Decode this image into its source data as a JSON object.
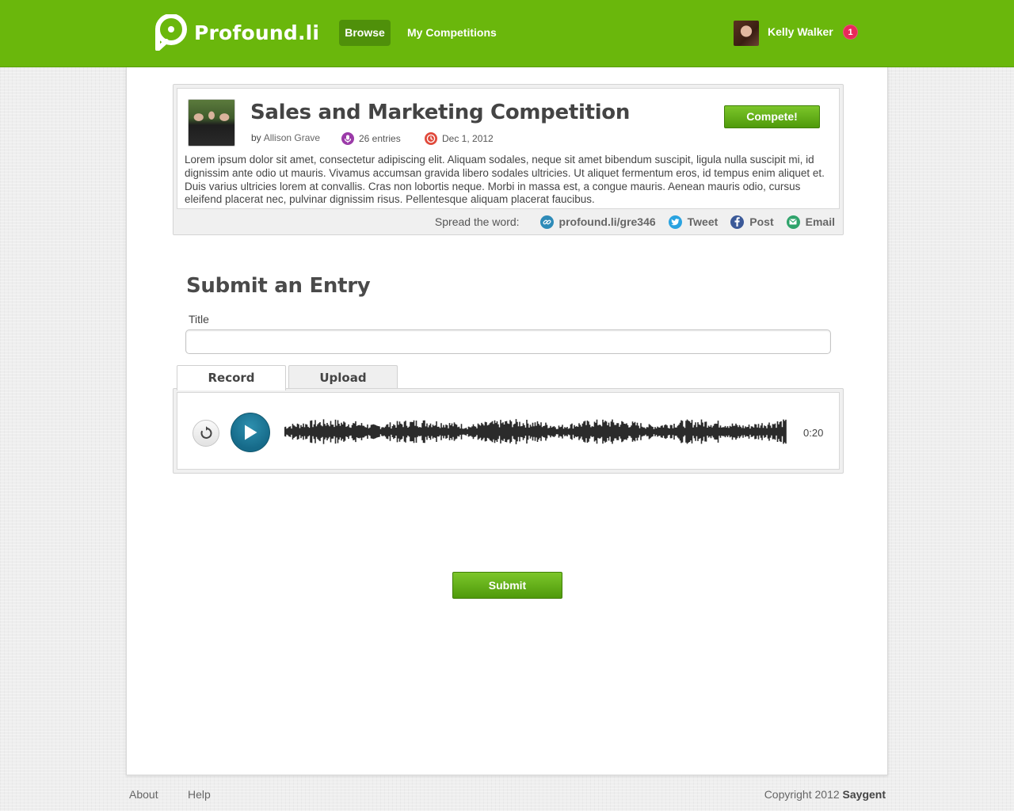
{
  "header": {
    "logo_text": "Profound.li",
    "nav": {
      "browse": "Browse",
      "my_competitions": "My Competitions"
    },
    "user": {
      "name": "Kelly Walker",
      "notifications": "1"
    }
  },
  "competition": {
    "title": "Sales and Marketing Competition",
    "by_label": "by",
    "author": "Allison Grave",
    "entries": "26 entries",
    "date": "Dec 1, 2012",
    "compete_button": "Compete!",
    "description": "Lorem ipsum dolor sit amet, consectetur adipiscing elit. Aliquam sodales, neque sit amet bibendum suscipit, ligula nulla suscipit mi, id dignissim ante odio ut mauris. Vivamus accumsan gravida libero sodales ultricies. Ut aliquet fermentum eros, id tempus enim aliquet et. Duis varius ultricies lorem at convallis. Cras non lobortis neque. Morbi in massa est, a congue mauris. Aenean mauris odio, cursus eleifend placerat nec, pulvinar dignissim risus. Pellentesque aliquam placerat faucibus.",
    "share": {
      "label": "Spread the word:",
      "link": "profound.li/gre346",
      "tweet": "Tweet",
      "post": "Post",
      "email": "Email"
    }
  },
  "entry_form": {
    "heading": "Submit an Entry",
    "title_label": "Title",
    "title_value": "",
    "tabs": {
      "record": "Record",
      "upload": "Upload"
    },
    "recorder": {
      "time": "0:20"
    },
    "submit_button": "Submit"
  },
  "footer": {
    "about": "About",
    "help": "Help",
    "copyright": "Copyright 2012",
    "company": "Saygent"
  },
  "colors": {
    "brand_green": "#6ab70c",
    "notification_pink": "#e8295a",
    "play_teal": "#1a7594"
  }
}
